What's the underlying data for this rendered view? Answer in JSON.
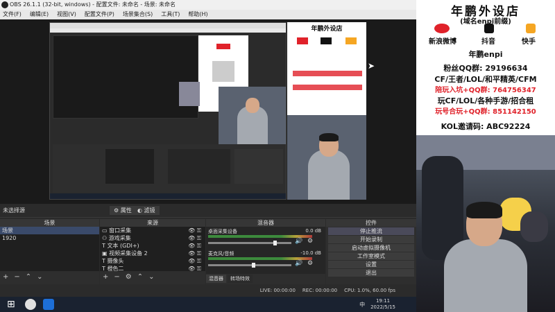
{
  "window": {
    "title": "OBS 26.1.1 (32-bit, windows) - 配置文件: 未命名 - 场景: 未命名"
  },
  "menu": [
    "文件(F)",
    "编辑(E)",
    "视图(V)",
    "配置文件(P)",
    "场景集合(S)",
    "工具(T)",
    "帮助(H)"
  ],
  "controls_bar": {
    "no_source": "未选择源",
    "properties": "属性",
    "filters": "滤镜"
  },
  "scenes": {
    "header": "场景",
    "items": [
      "场景",
      "1920"
    ]
  },
  "sources": {
    "header": "来源",
    "items": [
      "窗口采集",
      "游戏采集",
      "文本 (GDI+)",
      "视频采集设备 2",
      "摄像头",
      "橙色二"
    ]
  },
  "mixer": {
    "header": "混音器",
    "channels": [
      {
        "name": "桌面采集设备",
        "db": "0.0 dB",
        "level": 0.82
      },
      {
        "name": "麦克风/音频",
        "db": "-10.0 dB",
        "level": 0.55
      }
    ],
    "tabs": [
      "混音器",
      "转场特效"
    ]
  },
  "controls": {
    "header": "控件",
    "buttons": [
      "停止推流",
      "开始录制",
      "启动虚拟摄像机",
      "工作室模式",
      "设置",
      "退出"
    ]
  },
  "status": {
    "live": "LIVE: 00:00:00",
    "rec": "REC: 00:00:00",
    "cpu": "CPU: 1.0%, 60.00 fps"
  },
  "taskbar": {
    "time": "19:11",
    "date": "2022/5/15",
    "lang": "中"
  },
  "overlay": {
    "title": "年鹏外设店",
    "subtitle": "(域名enpi前缀)",
    "weibo": "新浪微博",
    "douyin": "抖音",
    "kuaishou": "快手",
    "handle": "年鹏enpi",
    "qq": "粉丝QQ群: 29196634",
    "line1": "CF/王者/LOL/和平精英/CFM",
    "line2": "陪玩入坑+QQ群: 764756347",
    "line3": "玩CF/LOL/各种手游/招合租",
    "line4": "玩号合玩+QQ群: 851142150",
    "kol": "KOL邀请码: ABC92224"
  },
  "colors": {
    "accent_red": "#e0222a",
    "obs_bg": "#2b2b2b"
  }
}
